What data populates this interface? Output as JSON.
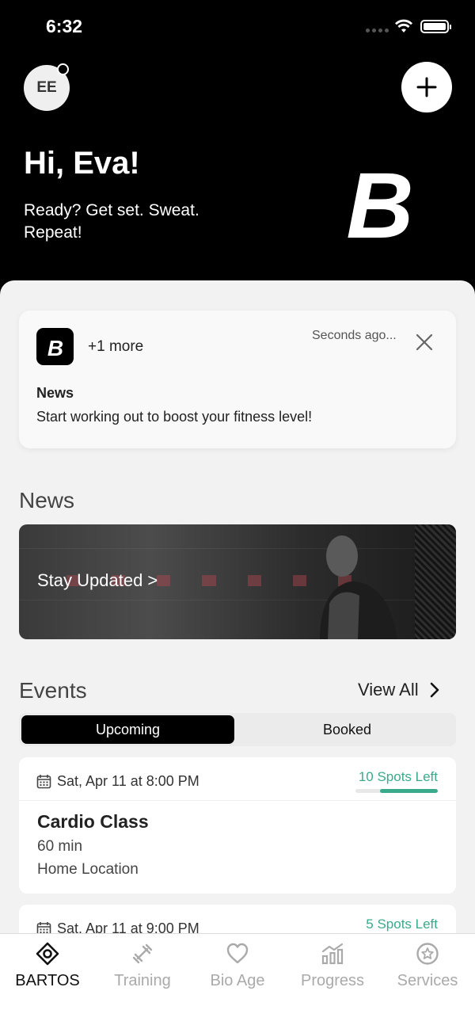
{
  "status_bar": {
    "time": "6:32"
  },
  "header": {
    "avatar_initials": "EE",
    "greeting": "Hi, Eva!",
    "tagline": "Ready? Get set. Sweat. Repeat!",
    "logo_letter": "B"
  },
  "notification": {
    "logo_letter": "B",
    "more": "+1 more",
    "time": "Seconds ago...",
    "title": "News",
    "body": "Start working out to boost your fitness level!"
  },
  "news": {
    "section_title": "News",
    "banner_cta": "Stay Updated >"
  },
  "events": {
    "section_title": "Events",
    "view_all": "View All",
    "tabs": [
      {
        "label": "Upcoming",
        "selected": true
      },
      {
        "label": "Booked",
        "selected": false
      }
    ],
    "items": [
      {
        "date": "Sat, Apr 11 at 8:00 PM",
        "spots": "10 Spots Left",
        "spots_fill": 0.7,
        "name": "Cardio Class",
        "duration": "60 min",
        "location": "Home Location"
      },
      {
        "date": "Sat, Apr 11 at 9:00 PM",
        "spots": "5 Spots Left"
      }
    ]
  },
  "tabbar": {
    "items": [
      {
        "label": "BARTOS",
        "icon": "eye-diamond-icon",
        "active": true
      },
      {
        "label": "Training",
        "icon": "dumbbell-icon",
        "active": false
      },
      {
        "label": "Bio Age",
        "icon": "heart-icon",
        "active": false
      },
      {
        "label": "Progress",
        "icon": "bar-chart-icon",
        "active": false
      },
      {
        "label": "Services",
        "icon": "star-badge-icon",
        "active": false
      }
    ]
  },
  "colors": {
    "accent_green": "#3aaa8c",
    "header_bg": "#000000"
  }
}
